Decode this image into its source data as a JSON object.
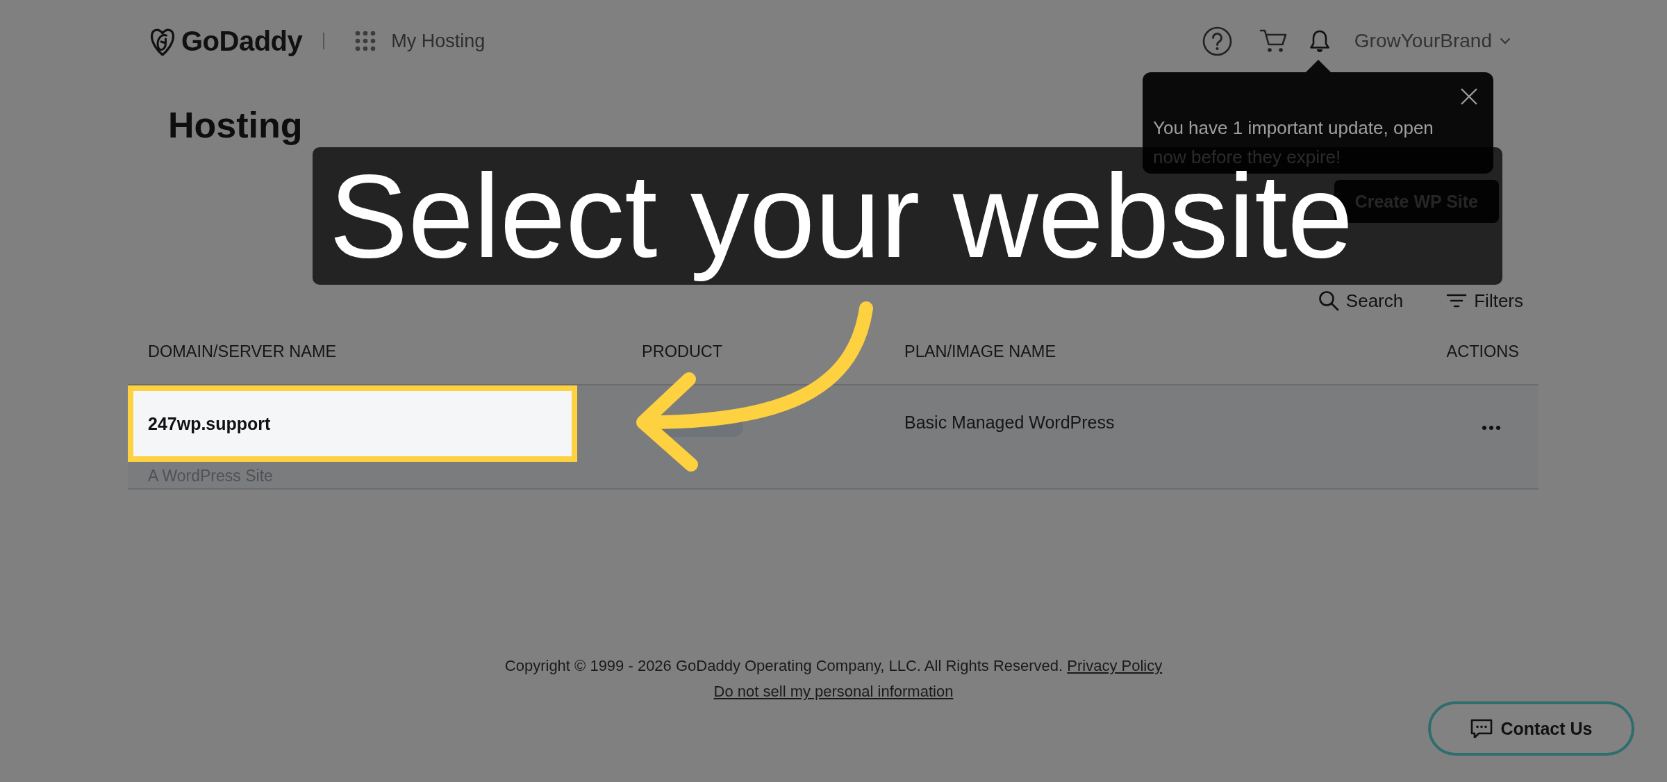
{
  "header": {
    "logo": "GoDaddy",
    "app_title": "My Hosting",
    "account": "GrowYourBrand"
  },
  "page_title": "Hosting",
  "notification_popup": {
    "message": "You have 1 important update, open now before they expire!"
  },
  "toolbar": {
    "create_button": "Create WP Site",
    "search": "Search",
    "filters": "Filters"
  },
  "table": {
    "columns": [
      "DOMAIN/SERVER NAME",
      "PRODUCT",
      "PLAN/IMAGE NAME",
      "ACTIONS"
    ],
    "rows": [
      {
        "domain": "247wp.support",
        "subtitle": "A WordPress Site",
        "highlighted": true,
        "plan": "Basic Managed WordPress"
      }
    ]
  },
  "footer": {
    "copyright": "Copyright © 1999 - 2026 GoDaddy Operating Company, LLC. All Rights Reserved.",
    "links": [
      "Privacy Policy",
      "Do not sell my personal information"
    ]
  },
  "contact_button": "Contact Us",
  "guide": {
    "caption": "Select your website"
  }
}
